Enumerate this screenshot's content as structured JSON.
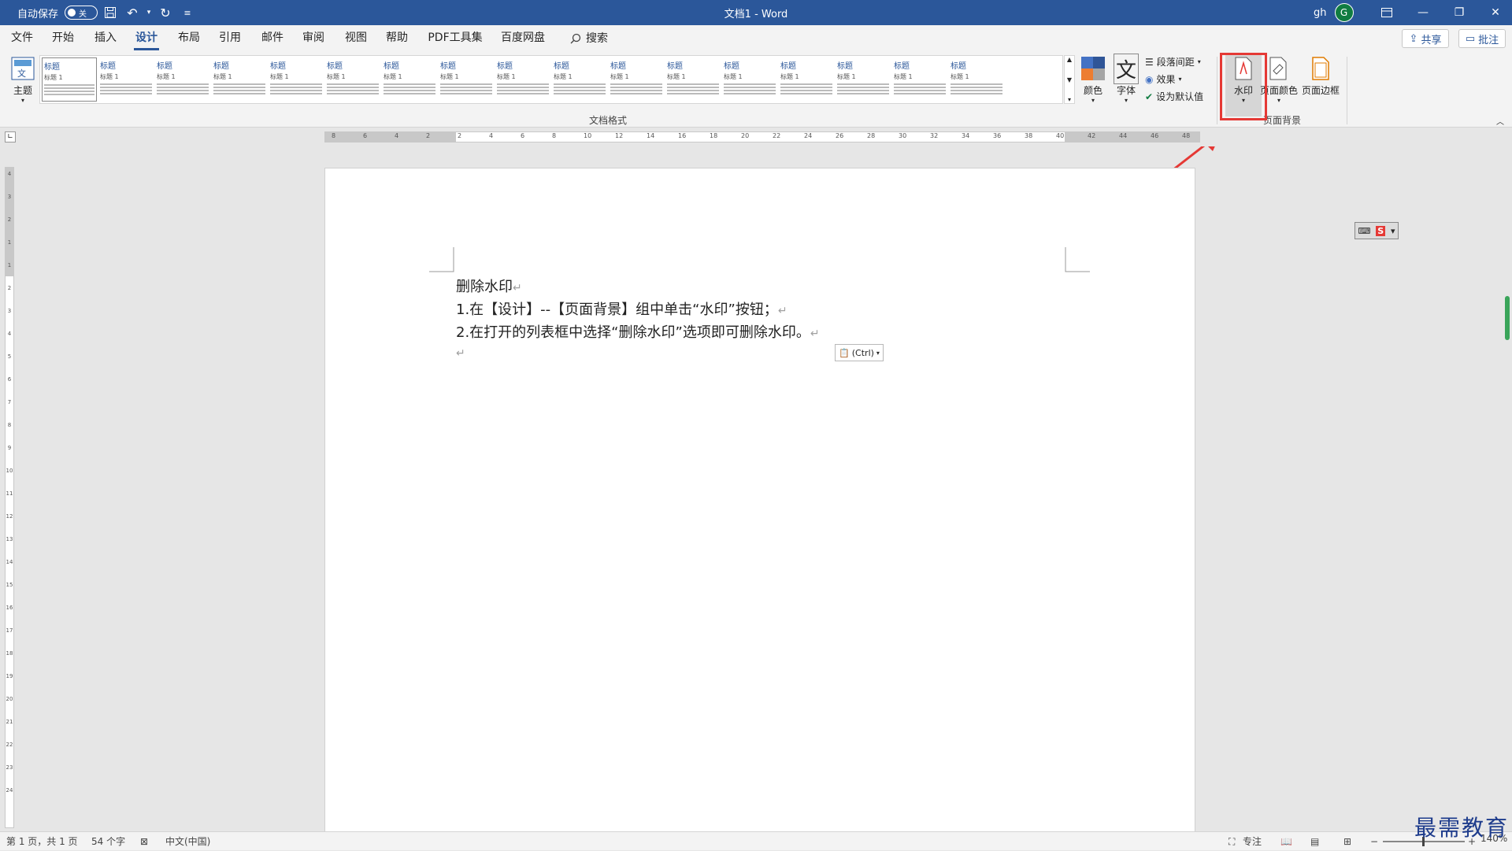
{
  "titlebar": {
    "autosave": "自动保存",
    "autosave_state": "关",
    "title": "文档1  -  Word",
    "user": "gh",
    "avatar": "G"
  },
  "menu": {
    "tabs": [
      "文件",
      "开始",
      "插入",
      "设计",
      "布局",
      "引用",
      "邮件",
      "审阅",
      "视图",
      "帮助",
      "PDF工具集",
      "百度网盘"
    ],
    "active": "设计",
    "search": "搜索",
    "share": "共享",
    "comment": "批注"
  },
  "ribbon": {
    "theme": "主题",
    "gallery_items": [
      {
        "head": "标题",
        "sub": "标题 1"
      },
      {
        "head": "标题",
        "sub": "标题 1"
      },
      {
        "head": "标题",
        "sub": "标题 1"
      },
      {
        "head": "标题",
        "sub": "标题 1"
      },
      {
        "head": "标题",
        "sub": "标题 1"
      },
      {
        "head": "标题",
        "sub": "标题 1"
      },
      {
        "head": "标题",
        "sub": "标题 1"
      },
      {
        "head": "标题",
        "sub": "标题 1"
      },
      {
        "head": "标题",
        "sub": "标题 1"
      },
      {
        "head": "标题",
        "sub": "标题 1"
      },
      {
        "head": "标题",
        "sub": "标题 1"
      },
      {
        "head": "标题",
        "sub": "标题 1"
      },
      {
        "head": "标题",
        "sub": "标题 1"
      },
      {
        "head": "标题",
        "sub": "标题 1"
      },
      {
        "head": "标题",
        "sub": "标题 1"
      },
      {
        "head": "标题",
        "sub": "标题 1"
      },
      {
        "head": "标题",
        "sub": "标题 1"
      }
    ],
    "group_docformat": "文档格式",
    "colors": "颜色",
    "fonts": "字体",
    "font_glyph": "文",
    "paragraph_spacing": "段落间距",
    "effects": "效果",
    "set_default": "设为默认值",
    "watermark": "水印",
    "page_color": "页面颜色",
    "page_border": "页面边框",
    "group_pagebg": "页面背景"
  },
  "ruler_labels": [
    "8",
    "6",
    "4",
    "2",
    "2",
    "4",
    "6",
    "8",
    "10",
    "12",
    "14",
    "16",
    "18",
    "20",
    "22",
    "24",
    "26",
    "28",
    "30",
    "32",
    "34",
    "36",
    "38",
    "40",
    "42",
    "44",
    "46",
    "48"
  ],
  "vruler_labels": [
    "4",
    "3",
    "2",
    "1",
    "1",
    "2",
    "3",
    "4",
    "5",
    "6",
    "7",
    "8",
    "9",
    "10",
    "11",
    "12",
    "13",
    "14",
    "15",
    "16",
    "17",
    "18",
    "19",
    "20",
    "21",
    "22",
    "23",
    "24"
  ],
  "document": {
    "lines": [
      "删除水印",
      "1.在【设计】--【页面背景】组中单击“水印”按钮；",
      "2.在打开的列表框中选择“删除水印”选项即可删除水印。",
      ""
    ],
    "paste_label": "(Ctrl)"
  },
  "statusbar": {
    "page": "第 1 页，共 1 页",
    "words": "54 个字",
    "lang": "中文(中国)",
    "focus": "专注",
    "zoom": "140%"
  },
  "brand": "最需教育",
  "colors": {
    "word_blue": "#2b579a",
    "highlight_red": "#e53935"
  }
}
